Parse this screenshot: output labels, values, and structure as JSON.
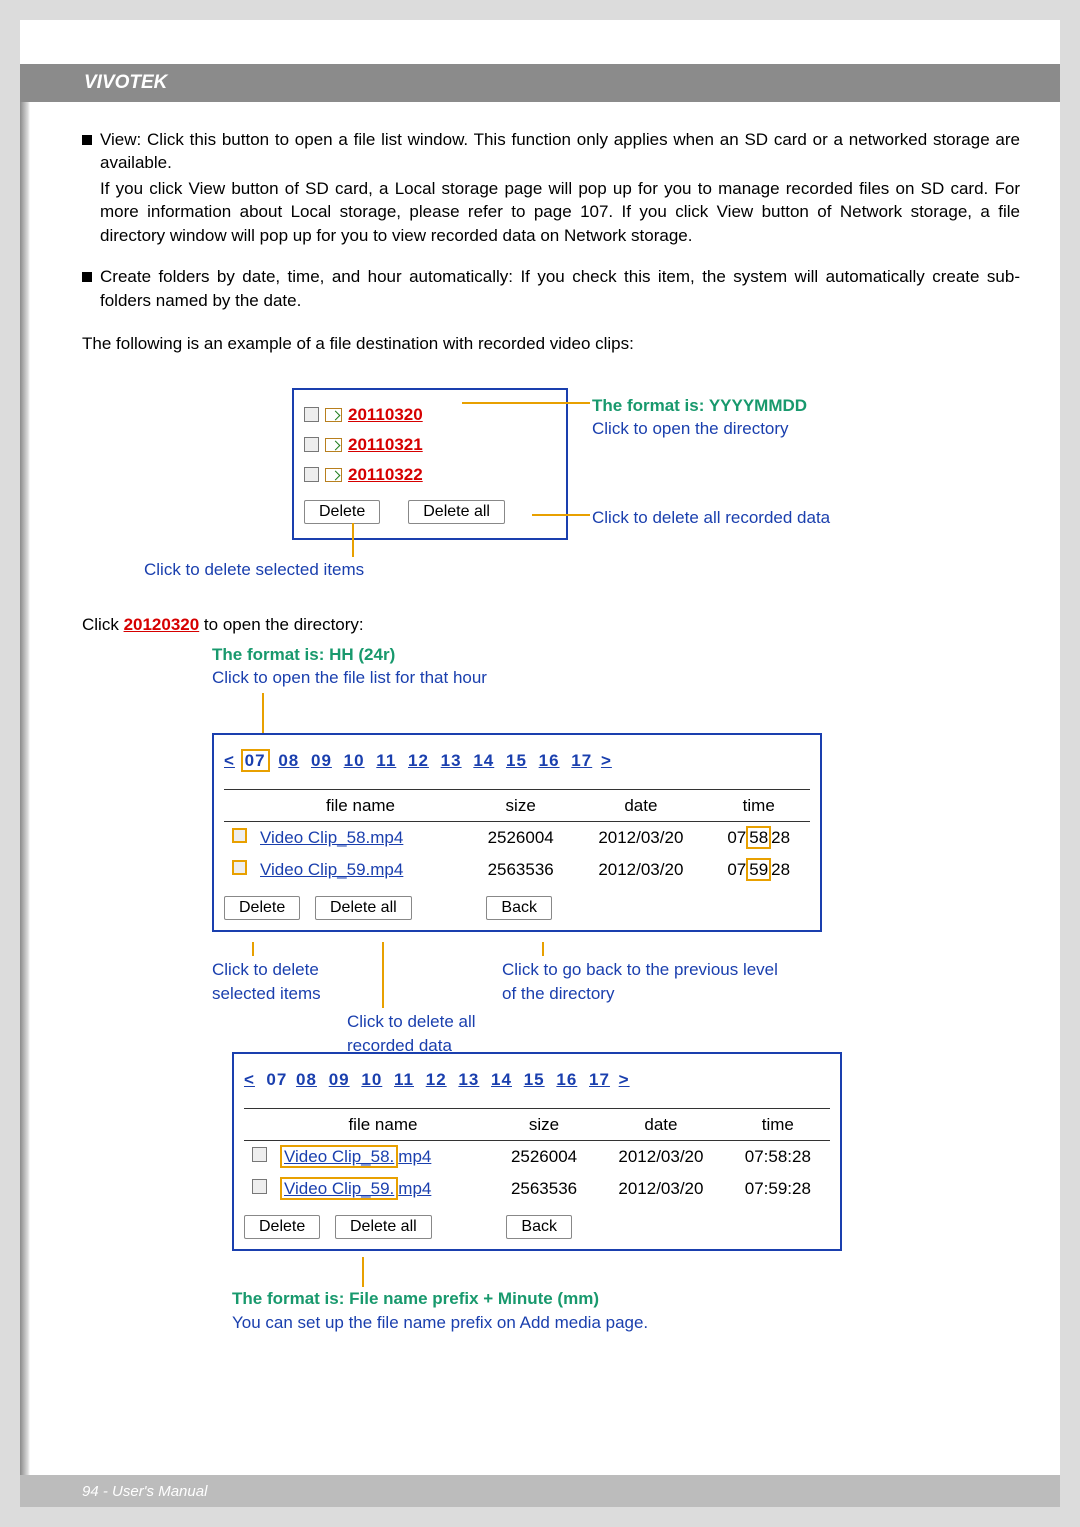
{
  "header": {
    "brand": "VIVOTEK"
  },
  "footer": {
    "text": "94 - User's Manual"
  },
  "paragraphs": {
    "view_bullet": "View: Click this button to open a file list window. This function only applies when an SD card or a networked storage are available.",
    "view_body": "If you click View button of SD card, a Local storage page will pop up for you to manage recorded files on SD card. For more information about Local storage, please refer to page 107. If you click View button of Network storage, a file directory window will pop up for you to view recorded data on Network storage.",
    "create_folders": "Create folders by date, time, and hour automatically: If you check this item, the system will automatically create sub-folders named by the date.",
    "example_intro": "The following is an example of a file destination with recorded video clips:",
    "click_open": "Click 20120320 to open the directory:"
  },
  "annotations": {
    "format_date": "The format is: YYYYMMDD",
    "click_open_dir": "Click to open the directory",
    "click_delete_all": "Click to delete all recorded data",
    "click_delete_sel": "Click to delete selected items",
    "format_hh": "The format is: HH (24r)",
    "click_open_hour": "Click to open the file list for that hour",
    "click_delete_sel2": "Click to delete selected items",
    "click_delete_all2": "Click to delete all recorded data",
    "click_back": "Click to go back to the previous level of the directory",
    "format_prefix": "The format is: File name prefix + Minute (mm)",
    "prefix_hint": "You can set up the file name prefix on Add media page."
  },
  "dirs": {
    "d1": "20110320",
    "d2": "20110321",
    "d3": "20110322"
  },
  "hours": [
    "07",
    "08",
    "09",
    "10",
    "11",
    "12",
    "13",
    "14",
    "15",
    "16",
    "17"
  ],
  "table": {
    "cols": {
      "fn": "file name",
      "sz": "size",
      "dt": "date",
      "tm": "time"
    },
    "rows": [
      {
        "fn": "Video Clip_58.mp4",
        "sz": "2526004",
        "dt": "2012/03/20",
        "tm": "07:58:28",
        "hh": "07",
        "mm": "58",
        "ss": "28"
      },
      {
        "fn": "Video Clip_59.mp4",
        "sz": "2563536",
        "dt": "2012/03/20",
        "tm": "07:59:28",
        "hh": "07",
        "mm": "59",
        "ss": "28"
      }
    ]
  },
  "buttons": {
    "delete": "Delete",
    "delete_all": "Delete all",
    "back": "Back"
  },
  "link_date": "20120320"
}
